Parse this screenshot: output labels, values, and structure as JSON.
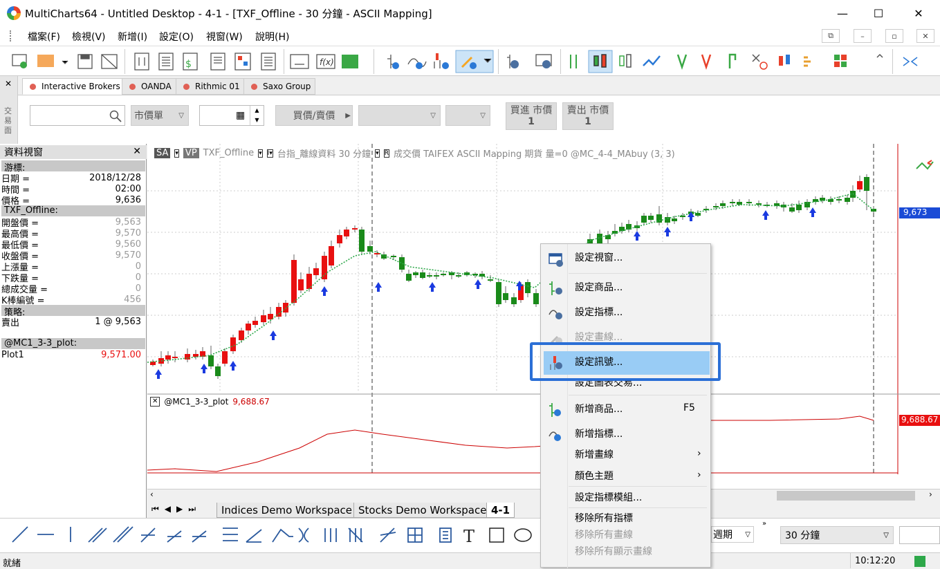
{
  "window": {
    "title": "MultiCharts64 - Untitled Desktop - 4-1 - [TXF_Offline - 30 分鐘 - ASCII Mapping]",
    "minimize": "—",
    "maximize": "☐",
    "close": "✕"
  },
  "menu": [
    "檔案(F)",
    "檢視(V)",
    "新增(I)",
    "設定(O)",
    "視窗(W)",
    "說明(H)"
  ],
  "broker": {
    "tabs": [
      "Interactive Brokers",
      "OANDA",
      "Rithmic 01",
      "Saxo Group"
    ],
    "side_label": "交易面",
    "order_type": "市價單",
    "action": "買價/賣價",
    "buy_label": "買進 市價",
    "buy_qty": "1",
    "sell_label": "賣出 市價",
    "sell_qty": "1"
  },
  "datawindow": {
    "title": "資料視窗",
    "cursor_section": "游標:",
    "rows1": [
      {
        "k": "日期 =",
        "v": "2018/12/28"
      },
      {
        "k": "時間 =",
        "v": "02:00"
      },
      {
        "k": "價格 =",
        "v": "9,636"
      }
    ],
    "symbol_section": "TXF_Offline:",
    "rows2": [
      {
        "k": "開盤價 =",
        "v": "9,563"
      },
      {
        "k": "最高價 =",
        "v": "9,570"
      },
      {
        "k": "最低價 =",
        "v": "9,560"
      },
      {
        "k": "收盤價 =",
        "v": "9,570"
      },
      {
        "k": "上漲量 =",
        "v": "0"
      },
      {
        "k": "下跌量 =",
        "v": "0"
      },
      {
        "k": "總成交量 =",
        "v": "0"
      },
      {
        "k": "K棒編號 =",
        "v": "456"
      }
    ],
    "strategy_section": "策略:",
    "strategy_row": {
      "k": "賣出",
      "v": "1 @ 9,563"
    },
    "plot_section": "@MC1_3-3_plot:",
    "plot_row": {
      "k": "Plot1",
      "v": "9,571.00"
    }
  },
  "chart": {
    "sa": "SA",
    "vp": "VP",
    "symbol": "TXF_Offline",
    "desc": "台指_離線資料 30 分鐘",
    "r": "R",
    "field": "成交價 TAIFEX ASCII Mapping 期貨 量=0 @MC_4-4_MAbuy (3, 3)",
    "price_badge": "9,673",
    "sub_title": "@MC1_3-3_plot",
    "sub_value": "9,688.67",
    "sub_badge": "9,688.67"
  },
  "context_menu": {
    "items": [
      "設定視窗...",
      "設定商品...",
      "設定指標...",
      "設定畫線...",
      "設定訊號...",
      "設定圖表交易...",
      "新增商品...",
      "新增指標...",
      "新增畫線",
      "顏色主題",
      "設定指標模組...",
      "移除所有指標",
      "移除所有畫線",
      "移除所有顯示畫線"
    ],
    "shortcut": "F5"
  },
  "tabs": [
    "Indices Demo Workspace",
    "Stocks Demo Workspace",
    "4-1"
  ],
  "bottom": {
    "period": "週期",
    "resolution": "30 分鐘"
  },
  "status": {
    "text": "就緒",
    "time": "10:12:20"
  },
  "colors": {
    "up": "#e81010",
    "down": "#1a8a1a",
    "highlight": "#2b6fd6",
    "menu_hover": "#99ccf5"
  }
}
